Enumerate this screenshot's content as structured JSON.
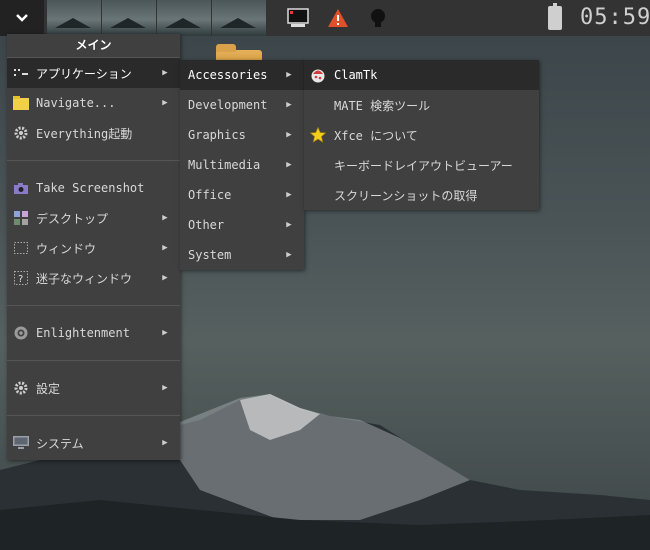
{
  "taskbar": {
    "menu_button": "⌄",
    "desktops": 4,
    "active_desktop": 1,
    "clock": "05:59"
  },
  "main_menu": {
    "title": "メイン",
    "items": [
      {
        "label": "アプリケーション",
        "icon": "applications-icon",
        "arrow": "▶"
      },
      {
        "label": "Navigate...",
        "icon": "folder-icon",
        "arrow": "▶"
      },
      {
        "label": "Everything起動",
        "icon": "gear-icon",
        "arrow": ""
      },
      {
        "label": "Take Screenshot",
        "icon": "camera-icon",
        "arrow": ""
      },
      {
        "label": "デスクトップ",
        "icon": "desktop-icon",
        "arrow": "▶"
      },
      {
        "label": "ウィンドウ",
        "icon": "window-icon",
        "arrow": "▶"
      },
      {
        "label": "迷子なウィンドウ",
        "icon": "lost-window-icon",
        "arrow": "▶"
      },
      {
        "label": "Enlightenment",
        "icon": "enlightenment-icon",
        "arrow": "▶"
      },
      {
        "label": "設定",
        "icon": "settings-gear-icon",
        "arrow": "▶"
      },
      {
        "label": "システム",
        "icon": "computer-icon",
        "arrow": "▶"
      }
    ]
  },
  "apps_menu": {
    "items": [
      {
        "label": "Accessories",
        "arrow": "▶"
      },
      {
        "label": "Development",
        "arrow": "▶"
      },
      {
        "label": "Graphics",
        "arrow": "▶"
      },
      {
        "label": "Multimedia",
        "arrow": "▶"
      },
      {
        "label": "Office",
        "arrow": "▶"
      },
      {
        "label": "Other",
        "arrow": "▶"
      },
      {
        "label": "System",
        "arrow": "▶"
      }
    ]
  },
  "accessories_menu": {
    "items": [
      {
        "label": "ClamTk",
        "icon": "clamtk-icon"
      },
      {
        "label": "MATE 検索ツール",
        "icon": ""
      },
      {
        "label": "Xfce について",
        "icon": "star-icon"
      },
      {
        "label": "キーボードレイアウトビューアー",
        "icon": ""
      },
      {
        "label": "スクリーンショットの取得",
        "icon": ""
      }
    ]
  },
  "colors": {
    "menu_bg": "#404040",
    "highlight_bg": "#2a2a2a",
    "taskbar_bg": "#333333",
    "active_desktop_border": "#4ea3f0"
  }
}
